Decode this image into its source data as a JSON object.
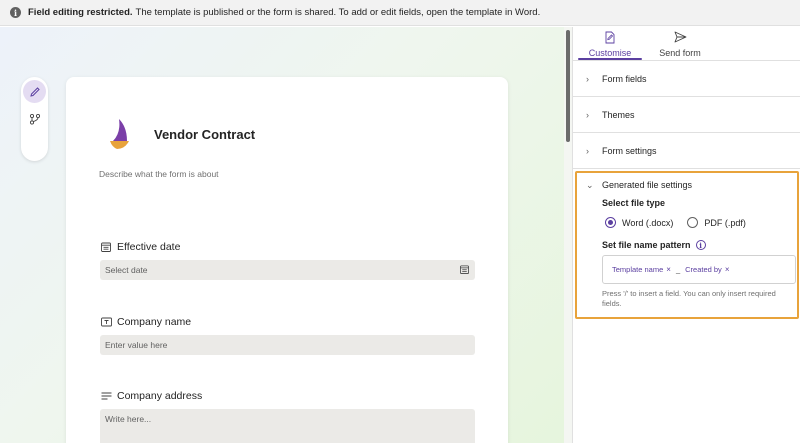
{
  "notice": {
    "bold_text": "Field editing restricted.",
    "text": "The template is published or the form is shared. To add or edit fields, open the template in Word."
  },
  "toolrail": {
    "icons": [
      "pencil-icon",
      "branch-icon"
    ]
  },
  "form": {
    "title": "Vendor Contract",
    "description": "Describe what the form is about",
    "fields": [
      {
        "label": "Effective date",
        "placeholder": "Select date",
        "icon": "calendar-icon"
      },
      {
        "label": "Company name",
        "placeholder": "Enter value here",
        "icon": "textbox-icon"
      },
      {
        "label": "Company address",
        "placeholder": "Write here...",
        "icon": "lines-icon"
      }
    ]
  },
  "panel": {
    "tabs": [
      {
        "label": "Customise",
        "icon": "customise-icon",
        "active": true
      },
      {
        "label": "Send form",
        "icon": "send-icon",
        "active": false
      }
    ],
    "sections": [
      "Form fields",
      "Themes",
      "Form settings"
    ],
    "generated": {
      "title": "Generated file settings",
      "file_type_label": "Select file type",
      "options": [
        {
          "label": "Word (.docx)",
          "selected": true
        },
        {
          "label": "PDF (.pdf)",
          "selected": false
        }
      ],
      "pattern_label": "Set file name pattern",
      "tokens": [
        "Template name",
        "Created by"
      ],
      "separator": "_",
      "hint": "Press '/' to insert a field. You can only insert required fields."
    }
  },
  "colors": {
    "accent": "#5b3fa0",
    "highlight_border": "#e8a33b"
  }
}
